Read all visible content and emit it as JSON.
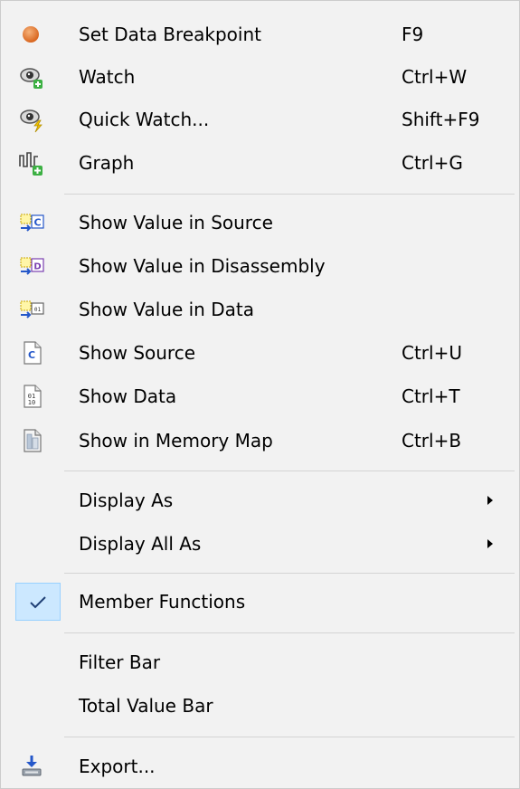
{
  "menu": {
    "items": [
      {
        "label": "Set Data Breakpoint",
        "shortcut": "F9",
        "icon": "breakpoint-icon"
      },
      {
        "label": "Watch",
        "shortcut": "Ctrl+W",
        "icon": "watch-icon"
      },
      {
        "label": "Quick Watch...",
        "shortcut": "Shift+F9",
        "icon": "quick-watch-icon"
      },
      {
        "label": "Graph",
        "shortcut": "Ctrl+G",
        "icon": "graph-icon"
      },
      {
        "label": "Show Value in Source",
        "shortcut": "",
        "icon": "show-value-source-icon"
      },
      {
        "label": "Show Value in Disassembly",
        "shortcut": "",
        "icon": "show-value-disassembly-icon"
      },
      {
        "label": "Show Value in Data",
        "shortcut": "",
        "icon": "show-value-data-icon"
      },
      {
        "label": "Show Source",
        "shortcut": "Ctrl+U",
        "icon": "source-file-icon"
      },
      {
        "label": "Show Data",
        "shortcut": "Ctrl+T",
        "icon": "data-file-icon"
      },
      {
        "label": "Show in Memory Map",
        "shortcut": "Ctrl+B",
        "icon": "memory-map-icon"
      },
      {
        "label": "Display As",
        "shortcut": "",
        "icon": "",
        "submenu": true
      },
      {
        "label": "Display All As",
        "shortcut": "",
        "icon": "",
        "submenu": true
      },
      {
        "label": "Member Functions",
        "shortcut": "",
        "icon": "checkmark-icon",
        "checked": true
      },
      {
        "label": "Filter Bar",
        "shortcut": "",
        "icon": ""
      },
      {
        "label": "Total Value Bar",
        "shortcut": "",
        "icon": ""
      },
      {
        "label": "Export...",
        "shortcut": "",
        "icon": "export-icon"
      }
    ]
  },
  "colors": {
    "menu_background": "#f2f2f2",
    "separator": "#d4d4d4",
    "check_highlight": "#cce8ff",
    "breakpoint": "#e07a2e",
    "plus_badge": "#3cb043"
  }
}
